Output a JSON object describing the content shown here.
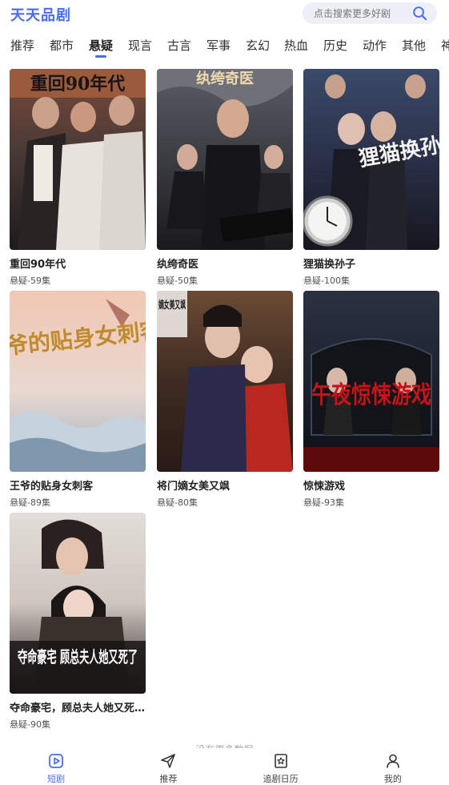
{
  "app": {
    "title": "天天品剧"
  },
  "search": {
    "placeholder": "点击搜索更多好剧",
    "icon": "search-icon"
  },
  "tabs": [
    {
      "label": "推荐",
      "active": false
    },
    {
      "label": "都市",
      "active": false
    },
    {
      "label": "悬疑",
      "active": true
    },
    {
      "label": "现言",
      "active": false
    },
    {
      "label": "古言",
      "active": false
    },
    {
      "label": "军事",
      "active": false
    },
    {
      "label": "玄幻",
      "active": false
    },
    {
      "label": "热血",
      "active": false
    },
    {
      "label": "历史",
      "active": false
    },
    {
      "label": "动作",
      "active": false
    },
    {
      "label": "其他",
      "active": false
    },
    {
      "label": "神",
      "active": false
    }
  ],
  "items": [
    {
      "title": "重回90年代",
      "meta": "悬疑-59集",
      "poster_text": "重回90年代"
    },
    {
      "title": "纨绔奇医",
      "meta": "悬疑-50集",
      "poster_text": "纨绔奇医"
    },
    {
      "title": "狸猫换孙子",
      "meta": "悬疑-100集",
      "poster_text": "狸猫换孙子"
    },
    {
      "title": "王爷的贴身女刺客",
      "meta": "悬疑-89集",
      "poster_text": "王爷的贴身女刺客"
    },
    {
      "title": "将门嫡女美又飒",
      "meta": "悬疑-80集",
      "poster_text": "嫡女美又飒"
    },
    {
      "title": "惊悚游戏",
      "meta": "悬疑-93集",
      "poster_text": "午夜惊悚游戏"
    },
    {
      "title": "夺命豪宅，顾总夫人她又死...",
      "meta": "悬疑-90集",
      "poster_text": "夺命豪宅 顾总夫人她又死了"
    }
  ],
  "footer": {
    "no_more": "没有更多数据"
  },
  "nav": [
    {
      "label": "短剧",
      "icon": "play-icon",
      "active": true
    },
    {
      "label": "推荐",
      "icon": "send-icon",
      "active": false
    },
    {
      "label": "追剧日历",
      "icon": "calendar-star-icon",
      "active": false
    },
    {
      "label": "我的",
      "icon": "user-icon",
      "active": false
    }
  ],
  "colors": {
    "accent": "#4a6cf0",
    "search_bg": "#edf0f7"
  }
}
